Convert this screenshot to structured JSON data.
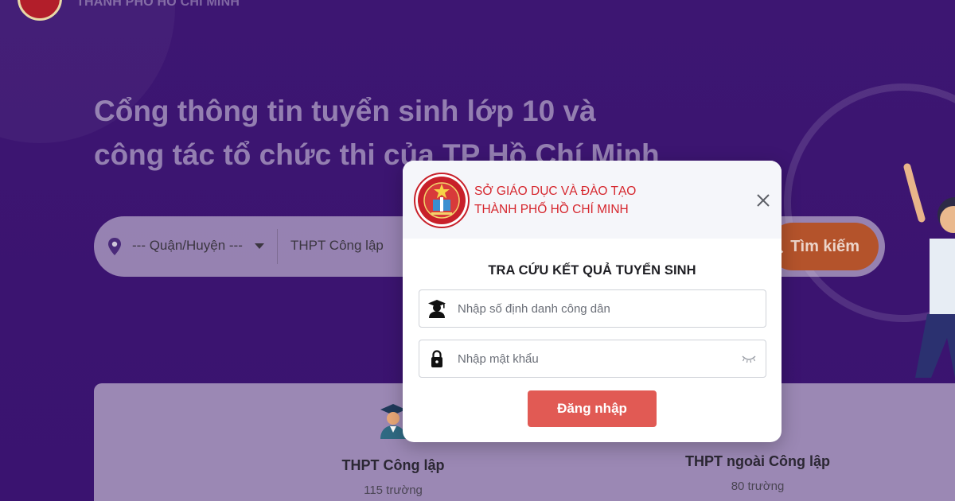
{
  "background": {
    "brand_line": "THÀNH PHỐ HỒ CHÍ MINH",
    "hero_title_line1": "Cổng thông tin tuyển sinh lớp 10 và",
    "hero_title_line2": "công tác tổ chức thi của TP Hồ Chí Minh",
    "search": {
      "district_placeholder": "--- Quận/Huyện ---",
      "school_type": "THPT Công lập",
      "search_button": "Tìm kiếm"
    },
    "stats": [
      {
        "title": "THPT Công lập",
        "count": "115 trường",
        "icon": "graduate-icon"
      },
      {
        "title": "THPT ngoài Công lập",
        "count": "80 trường",
        "icon": "school-icon"
      }
    ]
  },
  "modal": {
    "org_line1": "SỞ GIÁO DỤC VÀ ĐÀO TẠO",
    "org_line2": "THÀNH PHỐ HỒ CHÍ MINH",
    "title": "TRA CỨU KẾT QUẢ TUYỂN SINH",
    "id_field": {
      "placeholder": "Nhập số định danh công dân",
      "value": "",
      "icon": "student-icon"
    },
    "password_field": {
      "placeholder": "Nhập mật khẩu",
      "value": "",
      "icon": "lock-icon",
      "toggle_icon": "eye-closed-icon"
    },
    "login_button": "Đăng nhập",
    "close_icon": "close-icon"
  },
  "colors": {
    "background": "#3c1470",
    "accent_red": "#d6262d",
    "login_button": "#e15a54",
    "search_button": "#b4532b"
  }
}
